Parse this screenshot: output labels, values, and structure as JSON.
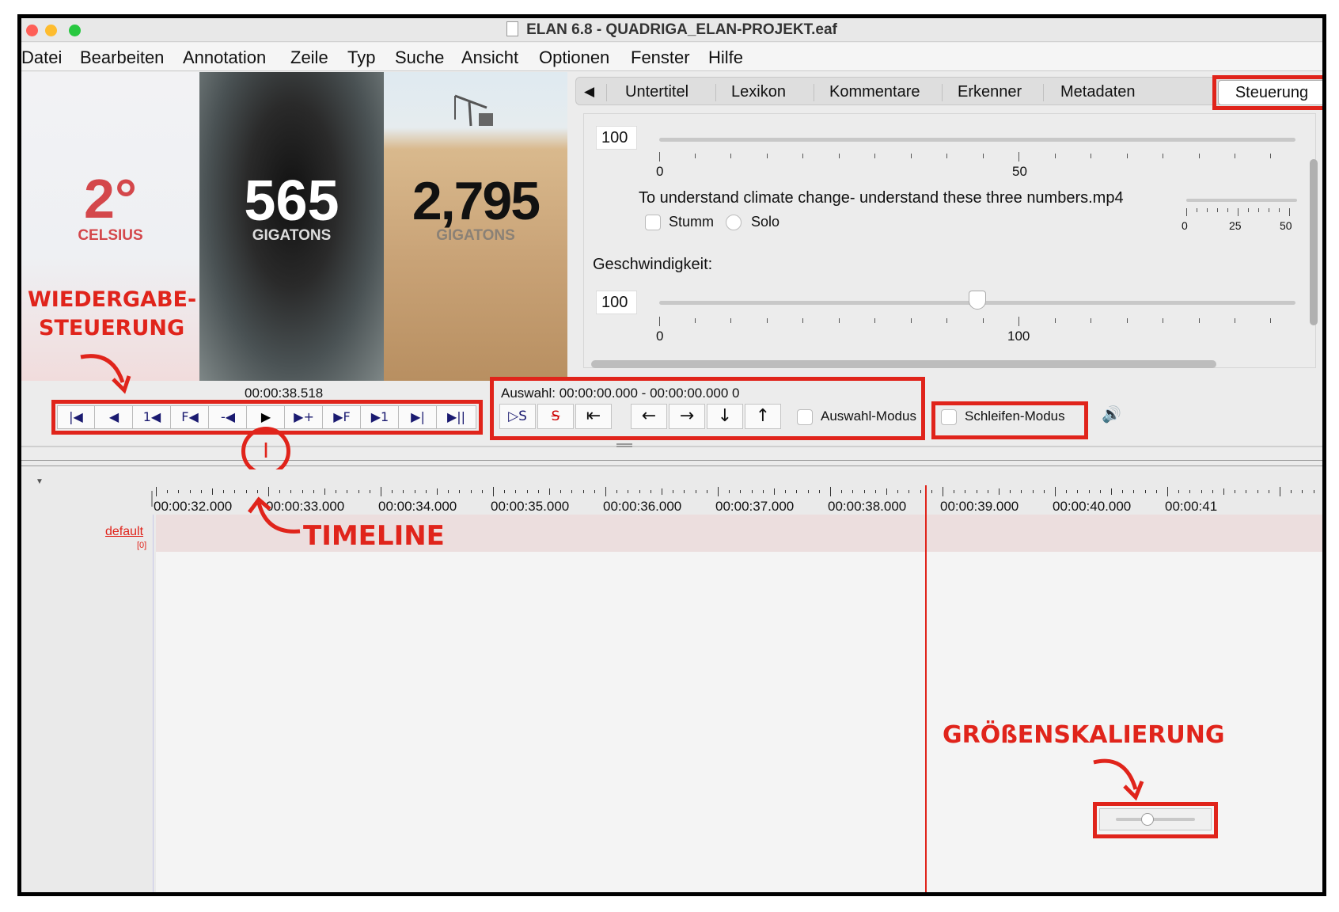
{
  "window": {
    "title": "ELAN 6.8 - QUADRIGA_ELAN-PROJEKT.eaf",
    "traffic_colors": [
      "#fe5f57",
      "#febc2e",
      "#28c840"
    ]
  },
  "menu": [
    "Datei",
    "Bearbeiten",
    "Annotation",
    "Zeile",
    "Typ",
    "Suche",
    "Ansicht",
    "Optionen",
    "Fenster",
    "Hilfe"
  ],
  "video": {
    "panel1": {
      "big": "2°",
      "small": "CELSIUS"
    },
    "panel2": {
      "big": "565",
      "small": "GIGATONS"
    },
    "panel3": {
      "big": "2,795",
      "small": "GIGATONS"
    }
  },
  "tabs": {
    "back_glyph": "◀",
    "items": [
      "Untertitel",
      "Lexikon",
      "Kommentare",
      "Erkenner",
      "Metadaten"
    ],
    "active": "Steuerung"
  },
  "controls_panel": {
    "volume_value": "100",
    "volume_ticks": [
      "0",
      "50"
    ],
    "media_file": "To understand climate change- understand these three numbers.mp4",
    "mute_label": "Stumm",
    "solo_label": "Solo",
    "media_ticks": [
      "0",
      "25",
      "50"
    ],
    "speed_label": "Geschwindigkeit:",
    "speed_value": "100",
    "speed_ticks": [
      "0",
      "100"
    ],
    "speed_level": 0.5
  },
  "playback": {
    "time": "00:00:38.518",
    "buttons": [
      "|◀",
      "◀",
      "1◀",
      "F◀",
      "-◀",
      "▶",
      "▶+",
      "▶F",
      "▶1",
      "▶|",
      "▶||"
    ]
  },
  "selection": {
    "text": "Auswahl: 00:00:00.000 - 00:00:00.000  0",
    "buttons": [
      "▷S",
      "S",
      "⇤"
    ],
    "nav_buttons": [
      "←",
      "→",
      "↓",
      "↑"
    ],
    "selection_mode": "Auswahl-Modus",
    "loop_mode": "Schleifen-Modus",
    "speaker_icon": "🔊"
  },
  "timeline": {
    "times": [
      "00:00:32.000",
      "00:00:33.000",
      "00:00:34.000",
      "00:00:35.000",
      "00:00:36.000",
      "00:00:37.000",
      "00:00:38.000",
      "00:00:39.000",
      "00:00:40.000",
      "00:00:41"
    ],
    "tier_name": "default",
    "tier_count": "[0]",
    "zoom_level": 0.4
  },
  "annotations": {
    "playback_label_1": "WIEDERGABE-",
    "playback_label_2": "STEUERUNG",
    "timeline_label": "TIMELINE",
    "scale_label": "GRÖßENSKALIERUNG",
    "color": "#e0241b"
  }
}
